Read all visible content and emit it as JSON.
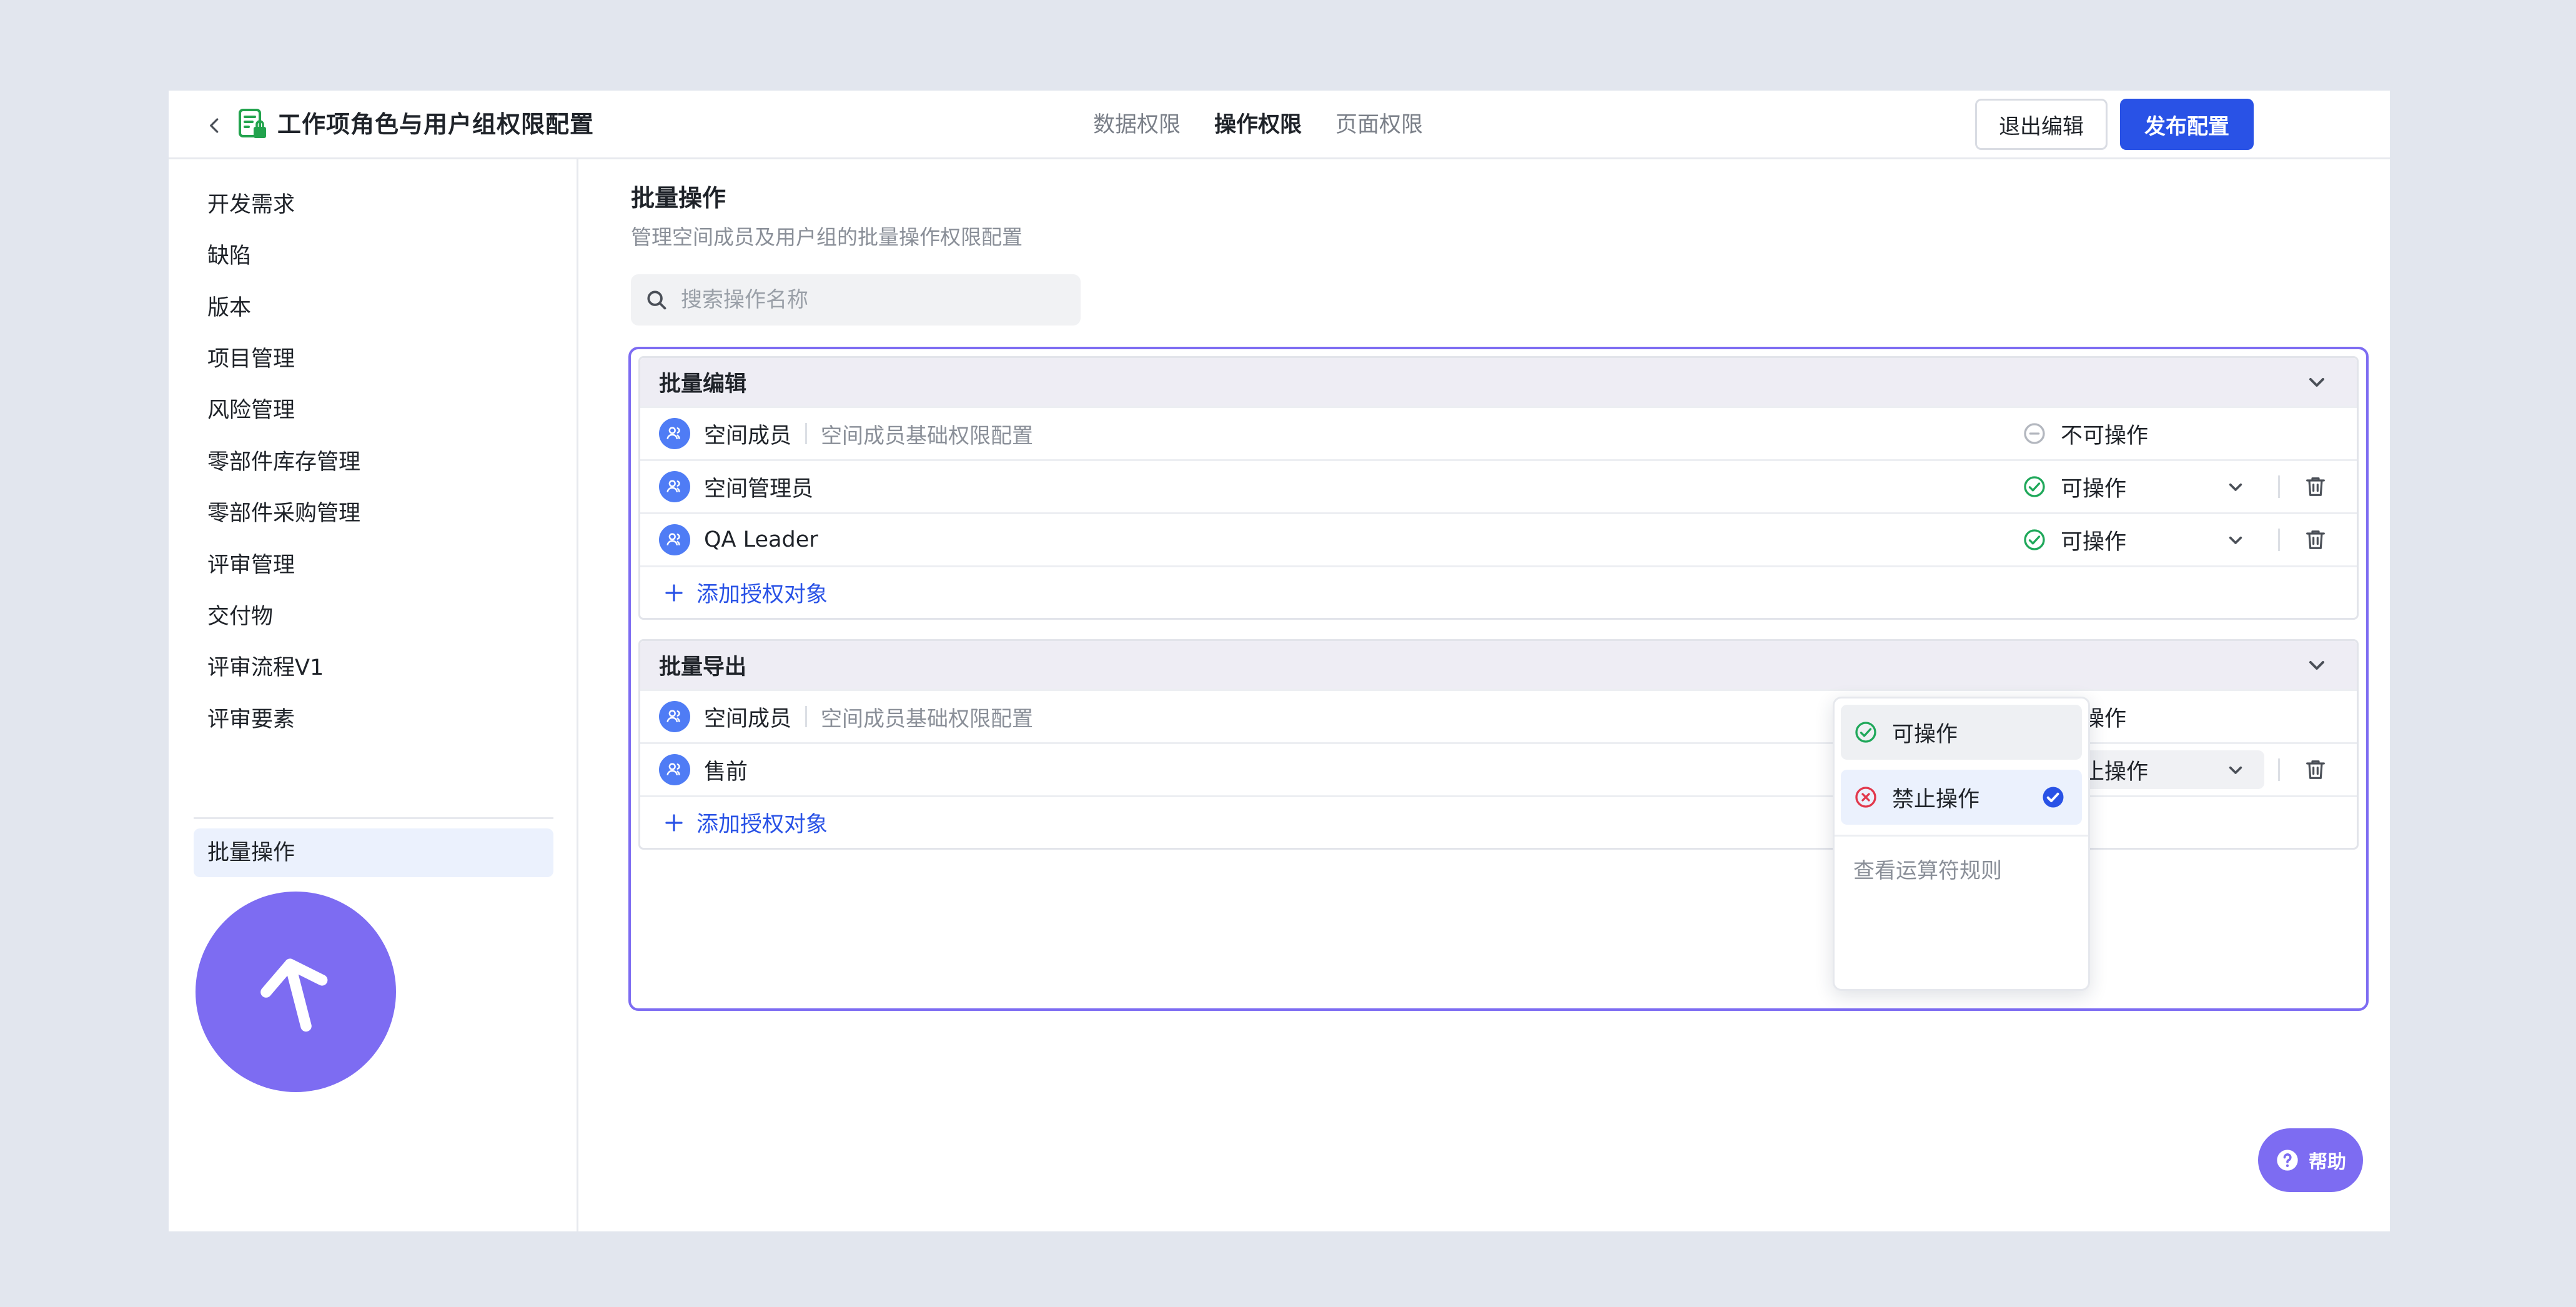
{
  "header": {
    "title": "工作项角色与用户组权限配置",
    "tabs": [
      {
        "label": "数据权限"
      },
      {
        "label": "操作权限"
      },
      {
        "label": "页面权限"
      }
    ],
    "active_tab": "操作权限",
    "exit_label": "退出编辑",
    "publish_label": "发布配置"
  },
  "sidebar": {
    "items": [
      {
        "label": "开发需求"
      },
      {
        "label": "缺陷"
      },
      {
        "label": "版本"
      },
      {
        "label": "项目管理"
      },
      {
        "label": "风险管理"
      },
      {
        "label": "零部件库存管理"
      },
      {
        "label": "零部件采购管理"
      },
      {
        "label": "评审管理"
      },
      {
        "label": "交付物"
      },
      {
        "label": "评审流程V1"
      },
      {
        "label": "评审要素"
      }
    ],
    "active_item": {
      "label": "批量操作"
    }
  },
  "main": {
    "title": "批量操作",
    "description": "管理空间成员及用户组的批量操作权限配置",
    "search": {
      "placeholder": "搜索操作名称",
      "value": ""
    },
    "groups": [
      {
        "title": "批量编辑",
        "rows": [
          {
            "name": "空间成员",
            "desc": "空间成员基础权限配置",
            "perm": "不可操作",
            "status": "neutral",
            "editable": false
          },
          {
            "name": "空间管理员",
            "desc": "",
            "perm": "可操作",
            "status": "allow",
            "editable": true
          },
          {
            "name": "QA Leader",
            "desc": "",
            "perm": "可操作",
            "status": "allow",
            "editable": true
          }
        ],
        "add_label": "添加授权对象"
      },
      {
        "title": "批量导出",
        "rows": [
          {
            "name": "空间成员",
            "desc": "空间成员基础权限配置",
            "perm": "可操作",
            "status": "allow",
            "editable": false
          },
          {
            "name": "售前",
            "desc": "",
            "perm": "禁止操作",
            "status": "deny",
            "editable": true
          }
        ],
        "add_label": "添加授权对象"
      }
    ]
  },
  "dropdown": {
    "options": [
      {
        "label": "可操作",
        "status": "allow"
      },
      {
        "label": "禁止操作",
        "status": "deny"
      }
    ],
    "selected": "禁止操作",
    "rules_link": "查看运算符规则"
  },
  "help": {
    "label": "帮助"
  },
  "colors": {
    "accent": "#2952e6",
    "purple": "#7d6cf2",
    "allow": "#1fa85a",
    "deny": "#e2384c",
    "neutral": "#b3b7bf"
  }
}
